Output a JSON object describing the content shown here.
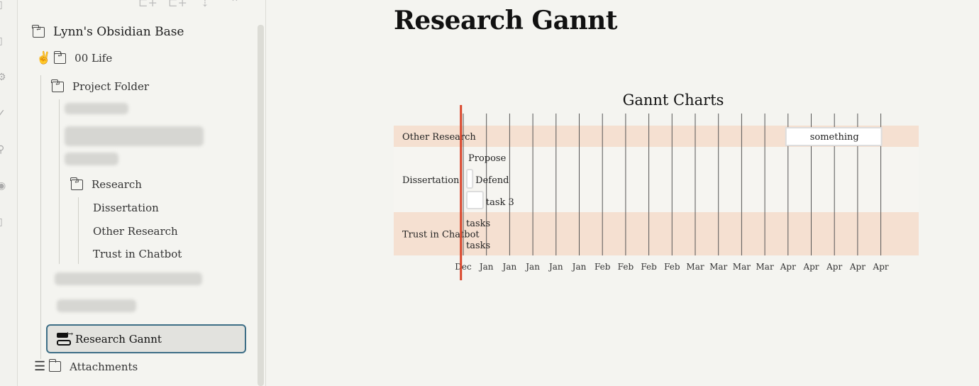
{
  "rail": {
    "icons": [
      "file-icon",
      "calendar-icon",
      "settings-icon",
      "check-icon",
      "link-icon",
      "wordpress-icon",
      "calendar-icon"
    ]
  },
  "sidebar": {
    "toolbar": [
      {
        "name": "new-note-icon",
        "glyph": "⊏+"
      },
      {
        "name": "new-folder-icon",
        "glyph": "⊏+"
      },
      {
        "name": "sort-icon",
        "glyph": "⇣"
      },
      {
        "name": "collapse-all-icon",
        "glyph": "⌃"
      }
    ],
    "vault_name": "Lynn's Obsidian Base",
    "items": [
      {
        "label": "00 Life",
        "type": "folder"
      },
      {
        "label": "Project Folder",
        "type": "folder"
      },
      {
        "label": "Research",
        "type": "folder"
      },
      {
        "label": "Dissertation",
        "type": "file"
      },
      {
        "label": "Other Research",
        "type": "file"
      },
      {
        "label": "Trust in Chatbot",
        "type": "file"
      },
      {
        "label": "Research Gannt",
        "type": "gantt",
        "selected": true
      },
      {
        "label": "Attachments",
        "type": "folder"
      }
    ]
  },
  "main": {
    "title": "Research Gannt"
  },
  "chart_data": {
    "type": "gantt",
    "title": "Gannt Charts",
    "sections": [
      {
        "name": "Other Research",
        "tasks": [
          {
            "label": "something",
            "start_tick": 14,
            "end_tick": 18
          }
        ]
      },
      {
        "name": "Dissertation",
        "tasks": [
          {
            "label": "Propose",
            "start_tick": 0,
            "end_tick": 0
          },
          {
            "label": "Defend",
            "start_tick": 0,
            "end_tick": 0.25
          },
          {
            "label": "task 3",
            "start_tick": 0,
            "end_tick": 0.7
          }
        ]
      },
      {
        "name": "Trust in Chatbot",
        "tasks": [
          {
            "label": "tasks",
            "start_tick": 0,
            "end_tick": 0
          },
          {
            "label": "tasks",
            "start_tick": 0,
            "end_tick": 0
          }
        ]
      }
    ],
    "x_ticks": [
      "Dec",
      "Jan",
      "Jan",
      "Jan",
      "Jan",
      "Jan",
      "Feb",
      "Feb",
      "Feb",
      "Feb",
      "Mar",
      "Mar",
      "Mar",
      "Mar",
      "Apr",
      "Apr",
      "Apr",
      "Apr",
      "Apr"
    ],
    "today_marker_tick": -0.1,
    "colors": {
      "section_band": "#f5e0d1",
      "section_band_alt": "#f6f5f1",
      "today_line": "#d9452a",
      "grid": "#555555",
      "task_fill": "#ffffff",
      "task_stroke": "#dddddd"
    }
  }
}
